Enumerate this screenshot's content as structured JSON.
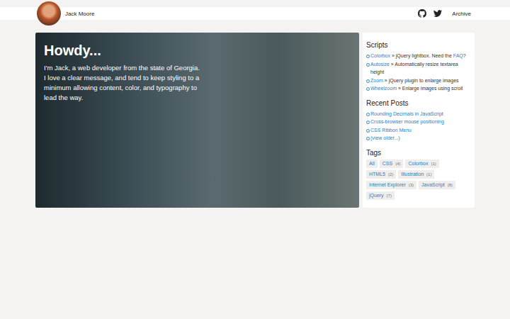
{
  "header": {
    "name": "Jack Moore",
    "nav": [
      "Archive"
    ]
  },
  "hero": {
    "title": "Howdy...",
    "text": "I'm Jack, a web developer from the state of Georgia. I love a clear message, and tend to keep styling to a minimum allowing content, color, and typography to lead the way."
  },
  "sidebar": {
    "scripts": {
      "title": "Scripts",
      "items": [
        {
          "name": "Colorbox",
          "separator": "»",
          "description": "jQuery lightbox. Need the",
          "link": "FAQ",
          "tail": "?"
        },
        {
          "name": "Autosize",
          "separator": "»",
          "description": "Automatically resize textarea height"
        },
        {
          "name": "Zoom",
          "separator": "»",
          "description": "jQuery plugin to enlarge images"
        },
        {
          "name": "Wheelzoom",
          "separator": "»",
          "description": "Enlarge images using scroll"
        }
      ]
    },
    "recent_posts": {
      "title": "Recent Posts",
      "items": [
        "Rounding Decimals in JavaScript",
        "Cross-browser mouse positioning",
        "CSS Ribbon Menu",
        "(view older...)"
      ]
    },
    "tags": {
      "title": "Tags",
      "items": [
        {
          "label": "All"
        },
        {
          "label": "CSS",
          "count": "(4)"
        },
        {
          "label": "Colorbox",
          "count": "(1)"
        },
        {
          "label": "HTML5",
          "count": "(2)"
        },
        {
          "label": "Illustration",
          "count": "(1)"
        },
        {
          "label": "Internet Explorer",
          "count": "(3)"
        },
        {
          "label": "JavaScript",
          "count": "(8)"
        },
        {
          "label": "jQuery",
          "count": "(7)"
        }
      ]
    }
  }
}
